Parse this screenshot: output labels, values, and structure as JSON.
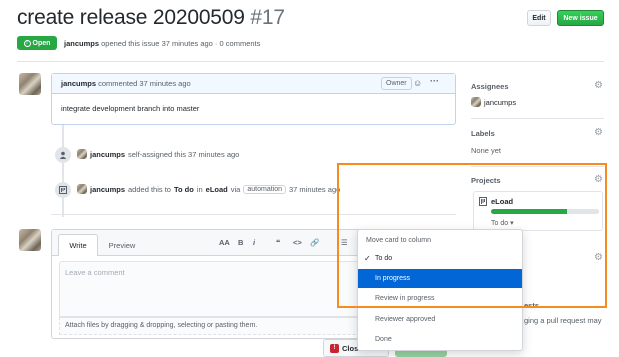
{
  "issue": {
    "title": "create release 20200509",
    "number": "#17",
    "state": "Open",
    "author": "jancumps",
    "meta_text": "opened this issue 37 minutes ago · 0 comments"
  },
  "header_buttons": {
    "edit": "Edit",
    "new_issue": "New issue"
  },
  "comment": {
    "author": "jancumps",
    "action": "commented 37 minutes ago",
    "owner_label": "Owner",
    "body": "integrate development branch into master"
  },
  "timeline": [
    {
      "author": "jancumps",
      "text": "self-assigned this 37 minutes ago"
    },
    {
      "author": "jancumps",
      "added": "added this to",
      "column": "To do",
      "in": "in",
      "project": "eLoad",
      "via": "via",
      "label": "automation",
      "time": "37 minutes ago"
    }
  ],
  "editor": {
    "tabs": [
      "Write",
      "Preview"
    ],
    "toolbar": [
      "AA",
      "B",
      "i",
      "❝",
      "<>",
      "🔗",
      "☰"
    ],
    "placeholder": "Leave a comment",
    "attach_hint": "Attach files by dragging & dropping, selecting or pasting them.",
    "close_label": "Close issue"
  },
  "sidebar": {
    "assignees_title": "Assignees",
    "assignee": "jancumps",
    "labels_title": "Labels",
    "labels_value": "None yet",
    "projects_title": "Projects",
    "project_name": "eLoad",
    "project_column": "To do ▾",
    "project_progress": 0.7,
    "linked_partial_1": "ests",
    "linked_partial_2": "ging a pull request may"
  },
  "dropdown": {
    "header": "Move card to column",
    "items": [
      {
        "label": "To do",
        "checked": true
      },
      {
        "label": "In progress",
        "selected": true
      },
      {
        "label": "Review in progress"
      },
      {
        "label": "Reviewer approved"
      },
      {
        "label": "Done"
      }
    ]
  },
  "colors": {
    "highlight": "#f68b1f",
    "selected": "#0366d6",
    "open": "#28a745"
  }
}
